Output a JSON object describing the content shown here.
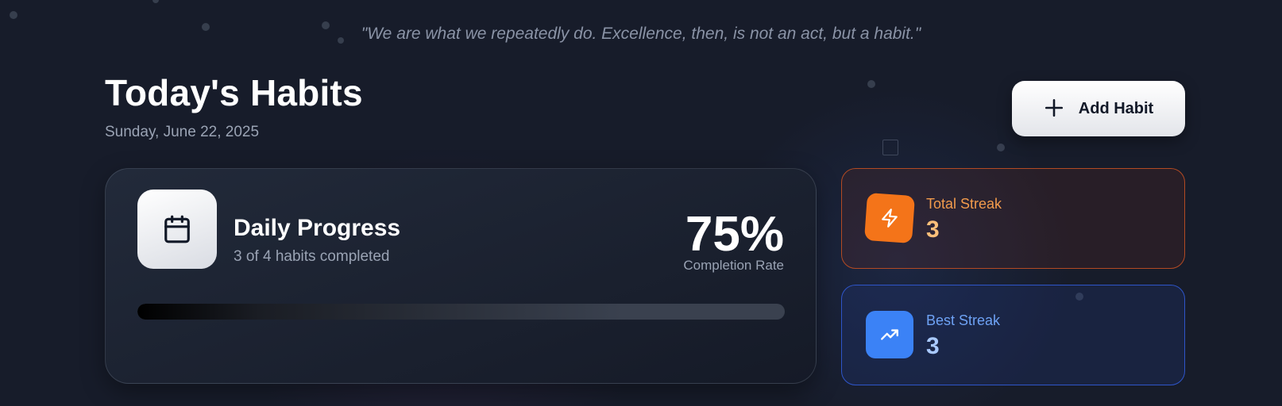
{
  "quote": "\"We are what we repeatedly do. Excellence, then, is not an act, but a habit.\"",
  "header": {
    "title": "Today's Habits",
    "date": "Sunday, June 22, 2025",
    "add_button_label": "Add Habit",
    "add_button_icon": "plus-icon"
  },
  "progress": {
    "icon": "calendar-icon",
    "title": "Daily Progress",
    "subtitle": "3 of 4 habits completed",
    "percent_text": "75%",
    "percent_label": "Completion Rate",
    "completed": 3,
    "total": 4,
    "fraction": 0.75
  },
  "stats": {
    "total_streak": {
      "label": "Total Streak",
      "value": "3",
      "icon": "lightning-icon",
      "accent": "#f47419"
    },
    "best_streak": {
      "label": "Best Streak",
      "value": "3",
      "icon": "trending-up-icon",
      "accent": "#3b82f6"
    }
  },
  "colors": {
    "background": "#171c2a",
    "text_muted": "#9aa3b4"
  }
}
